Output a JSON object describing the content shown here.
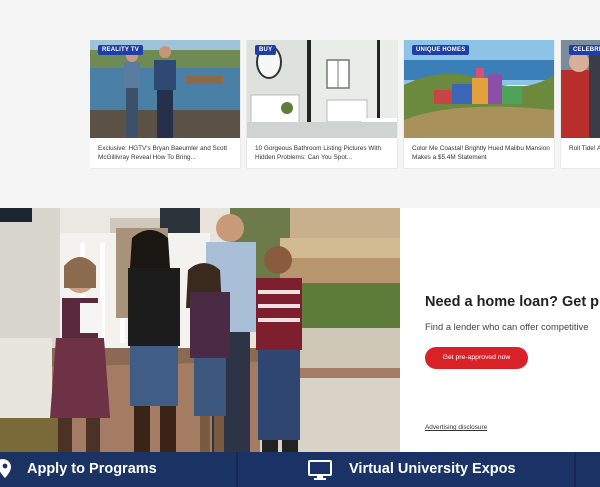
{
  "cards": [
    {
      "badge": "REALITY TV",
      "caption": "Exclusive: HGTV's Bryan Baeumler and Scott McGillivray Reveal How To Bring..."
    },
    {
      "badge": "BUY",
      "caption": "10 Gorgeous Bathroom Listing Pictures With Hidden Problems: Can You Spot..."
    },
    {
      "badge": "UNIQUE HOMES",
      "caption": "Color Me Coastal! Brightly Hued Malibu Mansion Makes a $5.4M Statement"
    },
    {
      "badge": "CELEBRIT",
      "caption": "Roll Tide! A Saban Sco"
    }
  ],
  "loan": {
    "heading": "Need a home loan? Get p",
    "subtext": "Find a lender who can offer competitive",
    "cta": "Get pre-approved now",
    "disclosure": "Advertising disclosure"
  },
  "bottom_bar": {
    "apply": "Apply to Programs",
    "expos": "Virtual University Expos"
  },
  "icons": [
    "location-pin-icon",
    "monitor-icon"
  ],
  "colors": {
    "badge": "#1f3ea6",
    "cta": "#d92228",
    "bar": "#14284f"
  }
}
